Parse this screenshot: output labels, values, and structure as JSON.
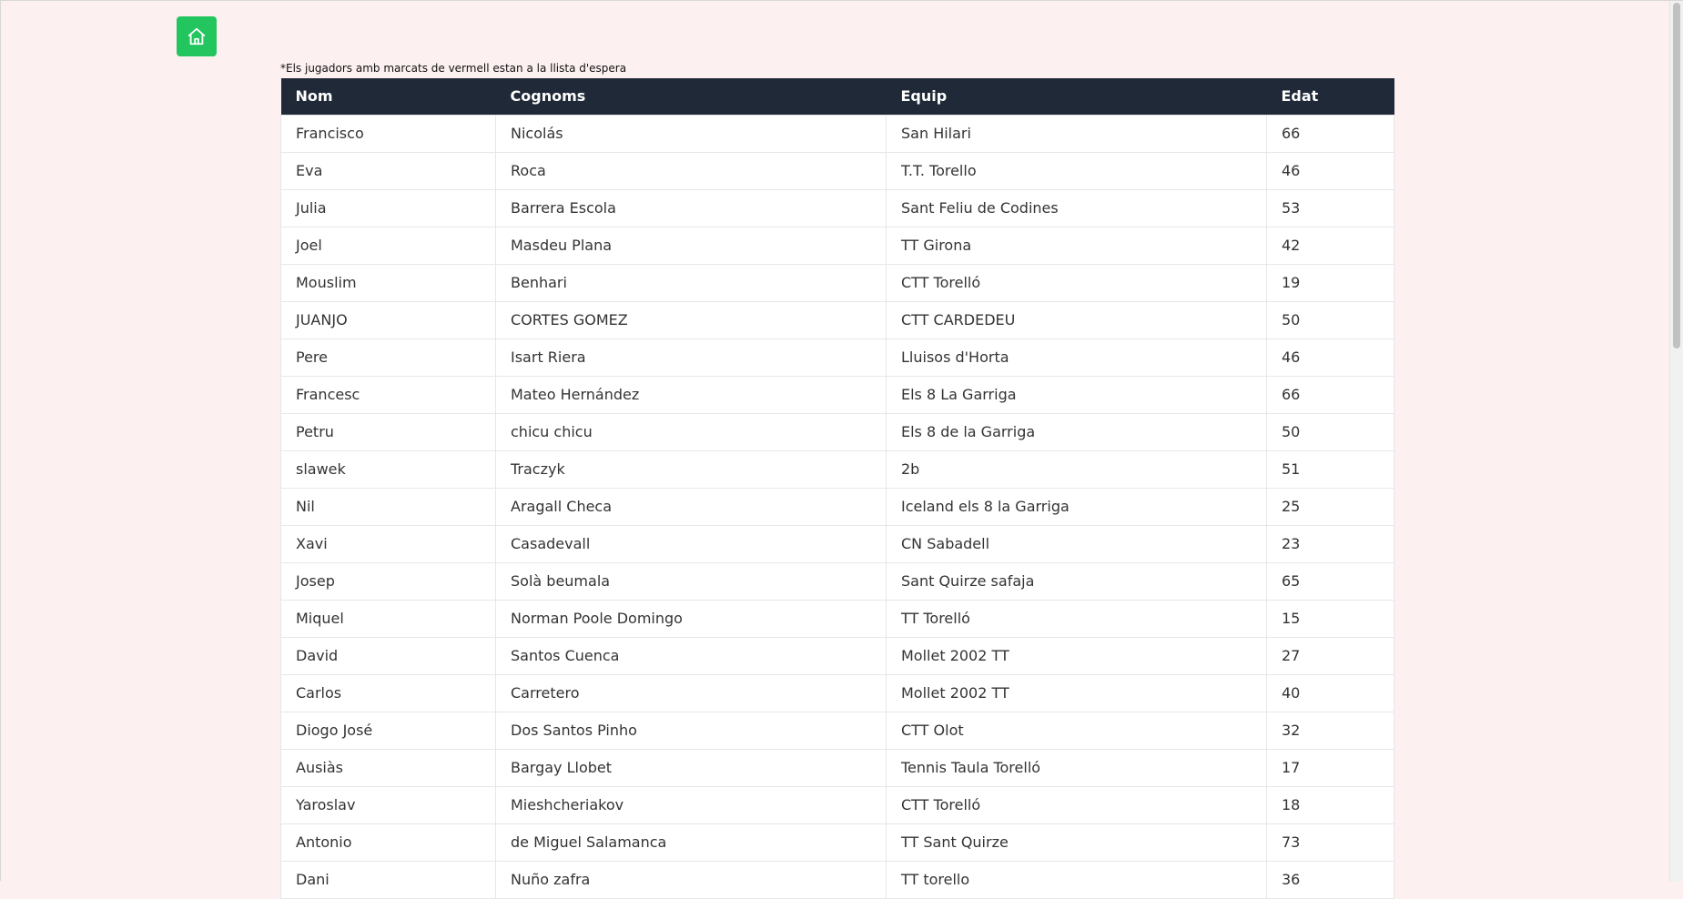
{
  "home": {
    "icon": "home-icon"
  },
  "note": "*Els jugadors amb marcats de vermell estan a la llista d'espera",
  "table": {
    "headers": [
      "Nom",
      "Cognoms",
      "Equip",
      "Edat"
    ],
    "rows": [
      [
        "Francisco",
        "Nicolás",
        "San Hilari",
        "66"
      ],
      [
        "Eva",
        "Roca",
        "T.T. Torello",
        "46"
      ],
      [
        "Julia",
        "Barrera Escola",
        "Sant Feliu de Codines",
        "53"
      ],
      [
        "Joel",
        "Masdeu Plana",
        "TT Girona",
        "42"
      ],
      [
        "Mouslim",
        "Benhari",
        "CTT Torelló",
        "19"
      ],
      [
        "JUANJO",
        "CORTES GOMEZ",
        "CTT CARDEDEU",
        "50"
      ],
      [
        "Pere",
        "Isart Riera",
        "Lluisos d'Horta",
        "46"
      ],
      [
        "Francesc",
        "Mateo Hernández",
        "Els 8 La Garriga",
        "66"
      ],
      [
        "Petru",
        "chicu chicu",
        "Els 8 de la Garriga",
        "50"
      ],
      [
        "slawek",
        "Traczyk",
        "2b",
        "51"
      ],
      [
        "Nil",
        "Aragall Checa",
        "Iceland els 8 la Garriga",
        "25"
      ],
      [
        "Xavi",
        "Casadevall",
        "CN Sabadell",
        "23"
      ],
      [
        "Josep",
        "Solà beumala",
        "Sant Quirze safaja",
        "65"
      ],
      [
        "Miquel",
        "Norman Poole Domingo",
        "TT Torelló",
        "15"
      ],
      [
        "David",
        "Santos Cuenca",
        "Mollet 2002 TT",
        "27"
      ],
      [
        "Carlos",
        "Carretero",
        "Mollet 2002 TT",
        "40"
      ],
      [
        "Diogo José",
        "Dos Santos Pinho",
        "CTT Olot",
        "32"
      ],
      [
        "Ausiàs",
        "Bargay Llobet",
        "Tennis Taula Torelló",
        "17"
      ],
      [
        "Yaroslav",
        "Mieshcheriakov",
        "CTT Torelló",
        "18"
      ],
      [
        "Antonio",
        "de Miguel Salamanca",
        "TT Sant Quirze",
        "73"
      ],
      [
        "Dani",
        "Nuño zafra",
        "TT torello",
        "36"
      ]
    ]
  },
  "colors": {
    "background": "#fdf0f0",
    "home_button": "#22c55e",
    "header": "#1f2937"
  }
}
